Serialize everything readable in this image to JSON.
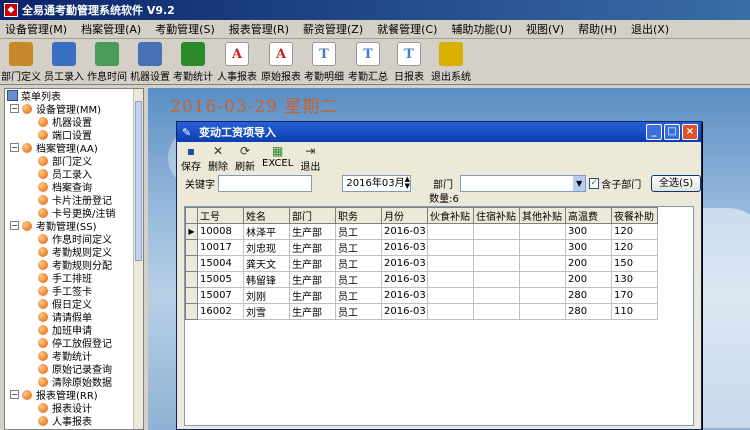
{
  "window": {
    "title": "全易通考勤管理系统软件 V9.2",
    "icon_name": "app-icon"
  },
  "menu": [
    "设备管理(M)",
    "档案管理(A)",
    "考勤管理(S)",
    "报表管理(R)",
    "薪资管理(Z)",
    "就餐管理(C)",
    "辅助功能(U)",
    "视图(V)",
    "帮助(H)",
    "退出(X)"
  ],
  "toolbar": [
    {
      "label": "部门定义",
      "icon": "department-icon",
      "color": "#c48a2a"
    },
    {
      "label": "员工录入",
      "icon": "employee-icon",
      "color": "#3a6ec0"
    },
    {
      "label": "作息时间",
      "icon": "clock-icon",
      "color": "#4a9a5a"
    },
    {
      "label": "机器设置",
      "icon": "computer-icon",
      "color": "#4670b8"
    },
    {
      "label": "考勤统计",
      "icon": "chart-icon",
      "color": "#2b8a2b"
    },
    {
      "label": "人事报表",
      "icon": "report-icon",
      "glyph": "A",
      "color": "#c82020"
    },
    {
      "label": "原始报表",
      "icon": "report-icon",
      "glyph": "A",
      "color": "#c82020"
    },
    {
      "label": "考勤明细",
      "icon": "report-icon",
      "glyph": "T",
      "color": "#4a7ac8"
    },
    {
      "label": "考勤汇总",
      "icon": "report-icon",
      "glyph": "T",
      "color": "#4a7ac8"
    },
    {
      "label": "日报表",
      "icon": "report-icon",
      "glyph": "T",
      "color": "#4a7ac8"
    },
    {
      "label": "退出系统",
      "icon": "exit-icon",
      "color": "#d8b000"
    }
  ],
  "tree": {
    "root": "菜单列表",
    "groups": [
      {
        "label": "设备管理(MM)",
        "items": [
          "机器设置",
          "端口设置"
        ]
      },
      {
        "label": "档案管理(AA)",
        "items": [
          "部门定义",
          "员工录入",
          "档案查询",
          "卡片注册登记",
          "卡号更换/注销"
        ]
      },
      {
        "label": "考勤管理(SS)",
        "items": [
          "作息时间定义",
          "考勤规则定义",
          "考勤规则分配",
          "手工排班",
          "手工签卡",
          "假日定义",
          "请请假单",
          "加班申请",
          "停工放假登记",
          "考勤统计",
          "原始记录查询",
          "清除原始数据"
        ]
      },
      {
        "label": "报表管理(RR)",
        "items": [
          "报表设计",
          "人事报表"
        ]
      }
    ]
  },
  "desktop": {
    "date_text": "2016-03-29 星期二"
  },
  "dialog": {
    "title": "变动工资项导入",
    "toolbar": [
      {
        "label": "保存",
        "icon": "save-icon",
        "glyph": "▪"
      },
      {
        "label": "删除",
        "icon": "delete-icon",
        "glyph": "✕"
      },
      {
        "label": "刷新",
        "icon": "refresh-icon",
        "glyph": "⟳"
      },
      {
        "label": "EXCEL",
        "icon": "excel-icon",
        "glyph": "▦"
      },
      {
        "label": "退出",
        "icon": "exit-icon",
        "glyph": "⇥"
      }
    ],
    "filter": {
      "keyword_label": "关键字",
      "keyword_value": "",
      "month_value": "2016年03月",
      "dept_label": "部门",
      "dept_value": "",
      "include_sub_label": "含子部门",
      "include_sub_checked": true,
      "select_all_label": "全选(S)"
    },
    "count_text": "数量:6",
    "table": {
      "columns": [
        "工号",
        "姓名",
        "部门",
        "职务",
        "月份",
        "伙食补贴",
        "住宿补贴",
        "其他补贴",
        "高温费",
        "夜餐补助"
      ],
      "rows": [
        [
          "10008",
          "林泽平",
          "生产部",
          "员工",
          "2016-03",
          "",
          "",
          "",
          "300",
          "120"
        ],
        [
          "10017",
          "刘忠现",
          "生产部",
          "员工",
          "2016-03",
          "",
          "",
          "",
          "300",
          "120"
        ],
        [
          "15004",
          "龚天文",
          "生产部",
          "员工",
          "2016-03",
          "",
          "",
          "",
          "200",
          "150"
        ],
        [
          "15005",
          "韩留锋",
          "生产部",
          "员工",
          "2016-03",
          "",
          "",
          "",
          "200",
          "130"
        ],
        [
          "15007",
          "刘刚",
          "生产部",
          "员工",
          "2016-03",
          "",
          "",
          "",
          "280",
          "170"
        ],
        [
          "16002",
          "刘雪",
          "生产部",
          "员工",
          "2016-03",
          "",
          "",
          "",
          "280",
          "110"
        ]
      ],
      "selected_row": 0
    }
  }
}
